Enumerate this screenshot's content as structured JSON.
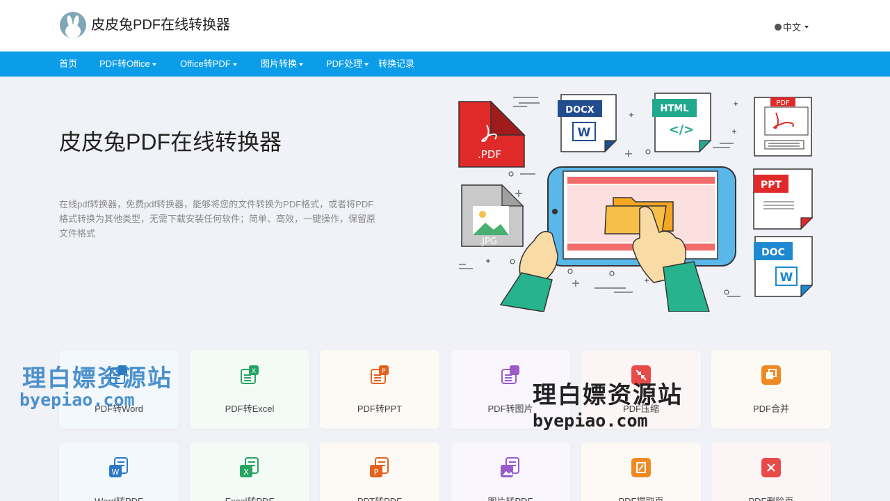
{
  "header": {
    "site_name": "皮皮兔PDF在线转换器",
    "language": "中文"
  },
  "nav": {
    "items": [
      {
        "label": "首页",
        "dropdown": false
      },
      {
        "label": "PDF转Office",
        "dropdown": true
      },
      {
        "label": "Office转PDF",
        "dropdown": true
      },
      {
        "label": "图片转换",
        "dropdown": true
      },
      {
        "label": "PDF处理",
        "dropdown": true
      },
      {
        "label": "转换记录",
        "dropdown": false
      }
    ]
  },
  "hero": {
    "title": "皮皮兔PDF在线转换器",
    "description": "在线pdf转换器，免费pdf转换器，能够将您的文件转换为PDF格式，或者将PDF格式转换为其他类型，无需下载安装任何软件；简单、高效，一键操作，保留原文件格式"
  },
  "illustration": {
    "pdf_label": ".PDF",
    "docx_label": "DOCX",
    "html_label": "HTML",
    "html_tag": "</>",
    "pdf_doc_label": "PDF",
    "jpg_label": ".JPG",
    "ppt_label": "PPT",
    "doc_label": "DOC",
    "word_letter": "W"
  },
  "tools": {
    "row1": [
      {
        "label": "PDF转Word",
        "icon": "pdf-to-word-icon",
        "color": "#2b79c4"
      },
      {
        "label": "PDF转Excel",
        "icon": "pdf-to-excel-icon",
        "color": "#27a463"
      },
      {
        "label": "PDF转PPT",
        "icon": "pdf-to-ppt-icon",
        "color": "#e2631f"
      },
      {
        "label": "PDF转图片",
        "icon": "pdf-to-image-icon",
        "color": "#9a5cc9"
      },
      {
        "label": "PDF压缩",
        "icon": "pdf-compress-icon",
        "color": "#e84a4a"
      },
      {
        "label": "PDF合并",
        "icon": "pdf-merge-icon",
        "color": "#ef8a22"
      }
    ],
    "row2": [
      {
        "label": "Word转PDF",
        "icon": "word-to-pdf-icon",
        "color": "#2b79c4"
      },
      {
        "label": "Excel转PDF",
        "icon": "excel-to-pdf-icon",
        "color": "#27a463"
      },
      {
        "label": "PPT转PDF",
        "icon": "ppt-to-pdf-icon",
        "color": "#e2631f"
      },
      {
        "label": "图片转PDF",
        "icon": "image-to-pdf-icon",
        "color": "#9a5cc9"
      },
      {
        "label": "PDF提取页",
        "icon": "pdf-extract-icon",
        "color": "#ef8a22"
      },
      {
        "label": "PDF删除页",
        "icon": "pdf-delete-icon",
        "color": "#e84a4a"
      }
    ]
  },
  "watermark": {
    "cn": "理白嫖资源站",
    "url": "byepiao.com"
  }
}
